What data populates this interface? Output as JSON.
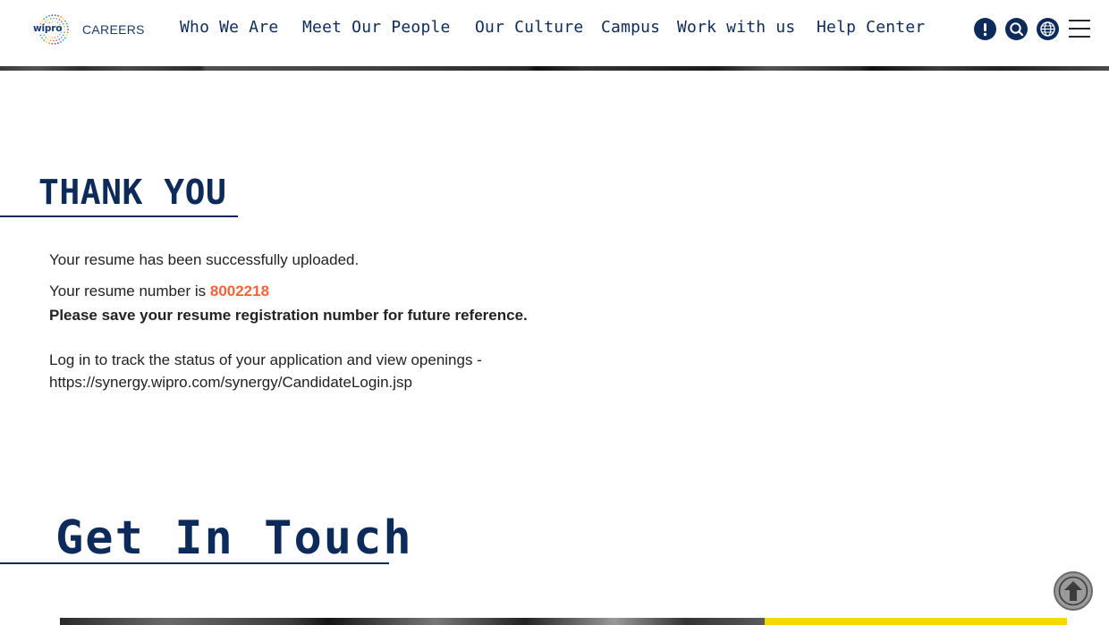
{
  "header": {
    "logo_text": "wipro",
    "section_label": "CAREERS",
    "nav": [
      {
        "label": "Who We Are"
      },
      {
        "label": "Meet Our People"
      },
      {
        "label": "Our Culture"
      },
      {
        "label": "Campus"
      },
      {
        "label": "Work with us"
      },
      {
        "label": "Help Center"
      }
    ],
    "icons": [
      "alert-icon",
      "search-icon",
      "globe-icon",
      "menu-icon"
    ]
  },
  "thank_you": {
    "title": "THANK YOU",
    "line1": "Your resume has been successfully uploaded.",
    "number_prefix": "Your resume number is ",
    "resume_number": "8002218",
    "save_note": "Please save your resume registration number for future reference.",
    "login_text": "Log in to track the status of your application and view openings -",
    "login_url": "https://synergy.wipro.com/synergy/CandidateLogin.jsp"
  },
  "get_in_touch": {
    "title": "Get In Touch"
  },
  "colors": {
    "brand_navy": "#0d2b5a",
    "accent_orange": "#f0643c",
    "accent_yellow": "#f5d800"
  }
}
